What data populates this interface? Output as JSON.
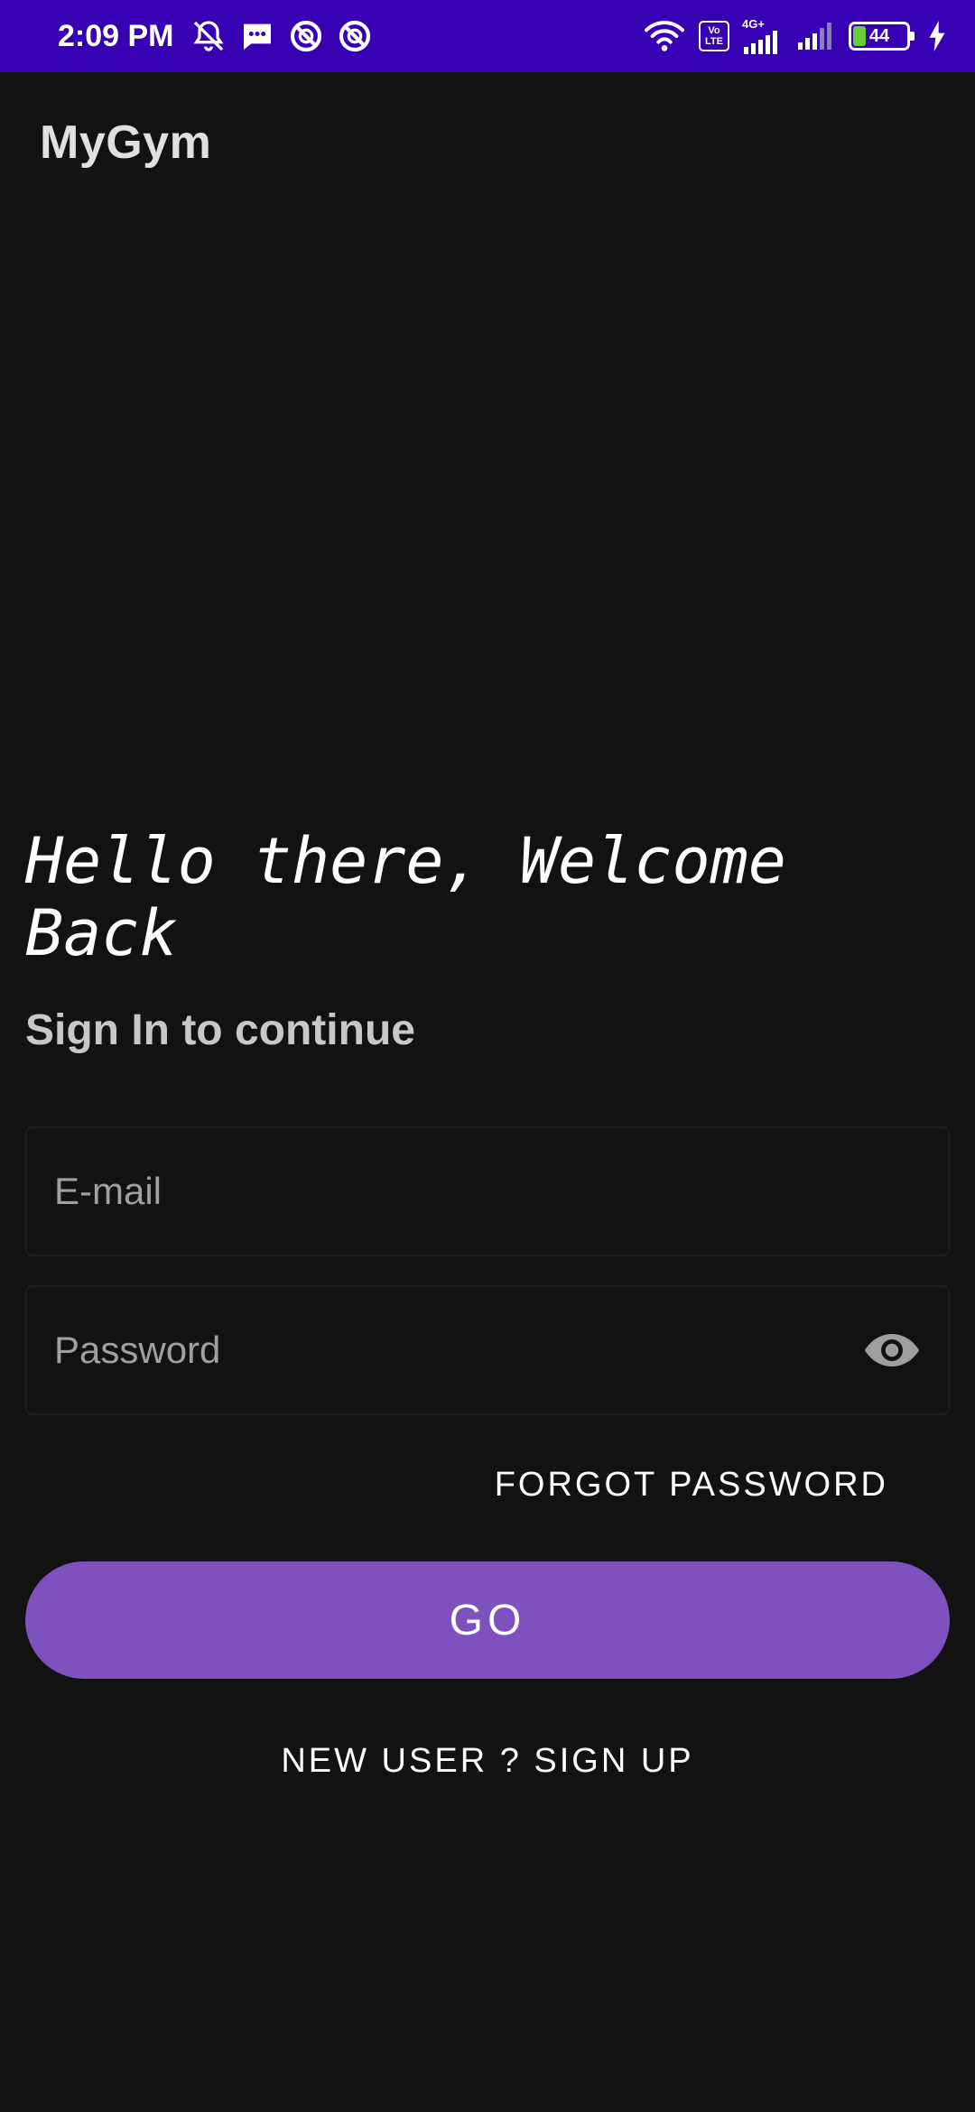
{
  "status_bar": {
    "time": "2:09 PM",
    "left_icons": [
      "muted-bell-icon",
      "message-icon",
      "blocked-app-icon",
      "blocked-app-icon"
    ],
    "right_icons": [
      "wifi-icon",
      "volte-icon",
      "signal-1-icon",
      "signal-2-icon",
      "battery-icon",
      "charging-icon"
    ],
    "volte_top": "Vo",
    "volte_bottom": "LTE",
    "network_type": "4G+",
    "battery_level": "44",
    "background_color": "#3700b3"
  },
  "app_bar": {
    "title": "MyGym"
  },
  "login": {
    "welcome_text": "Hello there, Welcome Back",
    "subtitle": "Sign In to continue",
    "email_placeholder": "E-mail",
    "password_placeholder": "Password",
    "password_toggle_icon": "eye-icon",
    "forgot_password_label": "FORGOT PASSWORD",
    "go_label": "GO",
    "signup_label": "NEW USER ? SIGN UP",
    "accent_color": "#7e51bf"
  }
}
